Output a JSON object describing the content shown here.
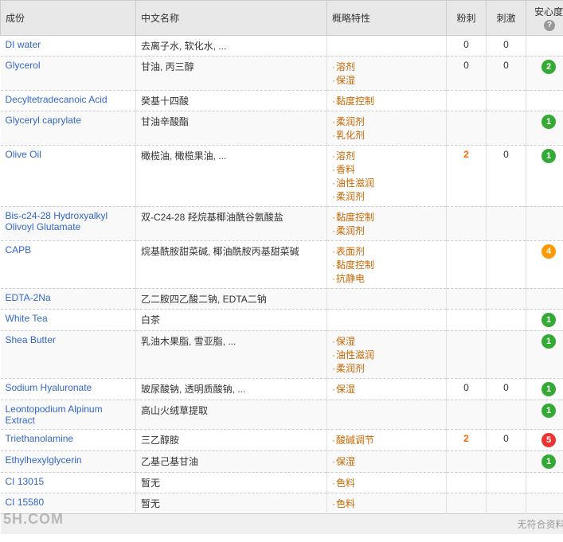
{
  "table": {
    "headers": [
      "成份",
      "中文名称",
      "概略特性",
      "粉刺",
      "刺激",
      "安心度"
    ],
    "rows": [
      {
        "ingredient": "DI water",
        "name": "去离子水, 软化水, ...",
        "properties": [],
        "prickle": "0",
        "irritate": "0",
        "safety": null,
        "safety_color": null,
        "safety_val": null
      },
      {
        "ingredient": "Glycerol",
        "name": "甘油, 丙三醇",
        "properties": [
          "溶剂",
          "保湿"
        ],
        "prickle": "0",
        "irritate": "0",
        "safety": "2",
        "safety_color": "green",
        "safety_val": "2"
      },
      {
        "ingredient": "Decyltetradecanoic Acid",
        "name": "癸基十四酸",
        "properties": [
          "黏度控制"
        ],
        "prickle": "",
        "irritate": "",
        "safety": null,
        "safety_color": null,
        "safety_val": null
      },
      {
        "ingredient": "Glyceryl caprylate",
        "name": "甘油辛酸酯",
        "properties": [
          "柔润剂",
          "乳化剂"
        ],
        "prickle": "",
        "irritate": "",
        "safety": "1",
        "safety_color": "green",
        "safety_val": "1"
      },
      {
        "ingredient": "Olive Oil",
        "name": "橄榄油, 橄榄果油, ...",
        "properties": [
          "溶剂",
          "香料",
          "油性滋润",
          "柔润剂"
        ],
        "prickle": "2",
        "irritate": "0",
        "safety": "1",
        "safety_color": "green",
        "safety_val": "1"
      },
      {
        "ingredient": "Bis-c24-28 Hydroxyalkyl Olivoyl Glutamate",
        "name": "双-C24-28 羟烷基椰油酰谷氨酸盐",
        "properties": [
          "黏度控制",
          "柔润剂"
        ],
        "prickle": "",
        "irritate": "",
        "safety": null,
        "safety_color": null,
        "safety_val": null
      },
      {
        "ingredient": "CAPB",
        "name": "烷基酰胺甜菜碱, 椰油酰胺丙基甜菜碱",
        "properties": [
          "表面剂",
          "黏度控制",
          "抗静电"
        ],
        "prickle": "",
        "irritate": "",
        "safety": "4",
        "safety_color": "orange",
        "safety_val": "4"
      },
      {
        "ingredient": "EDTA-2Na",
        "name": "乙二胺四乙酸二钠, EDTA二钠",
        "properties": [],
        "prickle": "",
        "irritate": "",
        "safety": null,
        "safety_color": null,
        "safety_val": null
      },
      {
        "ingredient": "White Tea",
        "name": "白茶",
        "properties": [],
        "prickle": "",
        "irritate": "",
        "safety": "1",
        "safety_color": "green",
        "safety_val": "1"
      },
      {
        "ingredient": "Shea Butter",
        "name": "乳油木果脂, 雪亚脂, ...",
        "properties": [
          "保湿",
          "油性滋润",
          "柔润剂"
        ],
        "prickle": "",
        "irritate": "",
        "safety": "1",
        "safety_color": "green",
        "safety_val": "1"
      },
      {
        "ingredient": "Sodium Hyaluronate",
        "name": "玻尿酸钠, 透明质酸钠, ...",
        "properties": [
          "保湿"
        ],
        "prickle": "0",
        "irritate": "0",
        "safety": "1",
        "safety_color": "green",
        "safety_val": "1"
      },
      {
        "ingredient": "Leontopodium Alpinum Extract",
        "name": "高山火绒草提取",
        "properties": [],
        "prickle": "",
        "irritate": "",
        "safety": "1",
        "safety_color": "green",
        "safety_val": "1"
      },
      {
        "ingredient": "Triethanolamine",
        "name": "三乙醇胺",
        "properties": [
          "酸碱调节"
        ],
        "prickle": "2",
        "irritate": "0",
        "safety": "5",
        "safety_color": "red",
        "safety_val": "5"
      },
      {
        "ingredient": "Ethylhexylglycerin",
        "name": "乙基己基甘油",
        "properties": [
          "保湿"
        ],
        "prickle": "",
        "irritate": "",
        "safety": "1",
        "safety_color": "green",
        "safety_val": "1"
      },
      {
        "ingredient": "CI 13015",
        "name": "暂无",
        "properties": [
          "色料"
        ],
        "prickle": "",
        "irritate": "",
        "safety": null,
        "safety_color": null,
        "safety_val": null
      },
      {
        "ingredient": "CI 15580",
        "name": "暂无",
        "properties": [
          "色料"
        ],
        "prickle": "",
        "irritate": "",
        "safety": null,
        "safety_color": null,
        "safety_val": null
      }
    ],
    "footer": "无符合资料"
  },
  "watermark": "5H.COM"
}
